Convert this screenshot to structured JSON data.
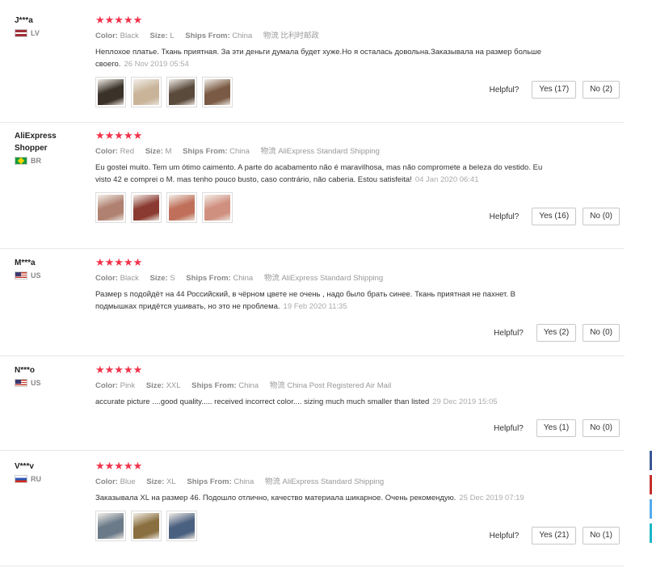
{
  "labels": {
    "color": "Color:",
    "size": "Size:",
    "ships_from": "Ships From:",
    "helpful": "Helpful?",
    "stars": "★★★★★"
  },
  "reviews": [
    {
      "user": "J***a",
      "country": "LV",
      "flag": "lv",
      "color": "Black",
      "size": "L",
      "ships_from": "China",
      "logistics": "物流 比利时邮政",
      "text": "Неплохое платье. Ткань приятная. За эти деньги думала будет хуже.Но я осталась довольна.Заказывала на размер больше своего.",
      "date": "26 Nov 2019 05:54",
      "yes": "Yes (17)",
      "no": "No (2)",
      "photos": [
        "photo-1",
        "photo-2",
        "photo-3",
        "photo-4"
      ]
    },
    {
      "user": "AliExpress Shopper",
      "country": "BR",
      "flag": "br",
      "color": "Red",
      "size": "M",
      "ships_from": "China",
      "logistics": "物流 AliExpress Standard Shipping",
      "text": "Eu gostei muito. Tem um ótimo caimento. A parte do acabamento não é maravilhosa, mas não compromete a beleza do vestido. Eu visto 42 e comprei o M. mas tenho pouco busto, caso contrário, não caberia. Estou satisfeita!",
      "date": "04 Jan 2020 06:41",
      "yes": "Yes (16)",
      "no": "No (0)",
      "photos": [
        "photo-1",
        "photo-2",
        "photo-3",
        "photo-4"
      ]
    },
    {
      "user": "M***a",
      "country": "US",
      "flag": "us",
      "color": "Black",
      "size": "S",
      "ships_from": "China",
      "logistics": "物流 AliExpress Standard Shipping",
      "text": "Размер s подойдёт на 44 Российский, в чёрном цвете не очень , надо было брать синее. Ткань приятная не пахнет. В подмышках придётся ушивать, но это не проблема.",
      "date": "19 Feb 2020 11:35",
      "yes": "Yes (2)",
      "no": "No (0)",
      "photos": []
    },
    {
      "user": "N***o",
      "country": "US",
      "flag": "us",
      "color": "Pink",
      "size": "XXL",
      "ships_from": "China",
      "logistics": "物流 China Post Registered Air Mail",
      "text": "accurate picture ....good quality..... received incorrect color.... sizing much much smaller than listed",
      "date": "29 Dec 2019 15:05",
      "yes": "Yes (1)",
      "no": "No (0)",
      "photos": []
    },
    {
      "user": "V***v",
      "country": "RU",
      "flag": "ru",
      "color": "Blue",
      "size": "XL",
      "ships_from": "China",
      "logistics": "物流 AliExpress Standard Shipping",
      "text": "Заказывала XL на размер 46. Подошло отлично, качество материала шикарное. Очень рекомендую.",
      "date": "25 Dec 2019 07:19",
      "yes": "Yes (21)",
      "no": "No (1)",
      "photos": [
        "photo-1",
        "photo-2",
        "photo-3"
      ]
    }
  ],
  "photo_colors": [
    [
      "#3a3128",
      "#c9b49a",
      "#5a4a3c",
      "#7a5a44"
    ],
    [
      "#b08070",
      "#8a3a30",
      "#c0705a",
      "#d09080"
    ],
    [],
    [],
    [
      "#6a7a88",
      "#8a7040",
      "#4a6080"
    ]
  ],
  "sidebar_colors": [
    "#3b5998",
    "#c4302b",
    "#55acee",
    "#1ab7c9"
  ]
}
